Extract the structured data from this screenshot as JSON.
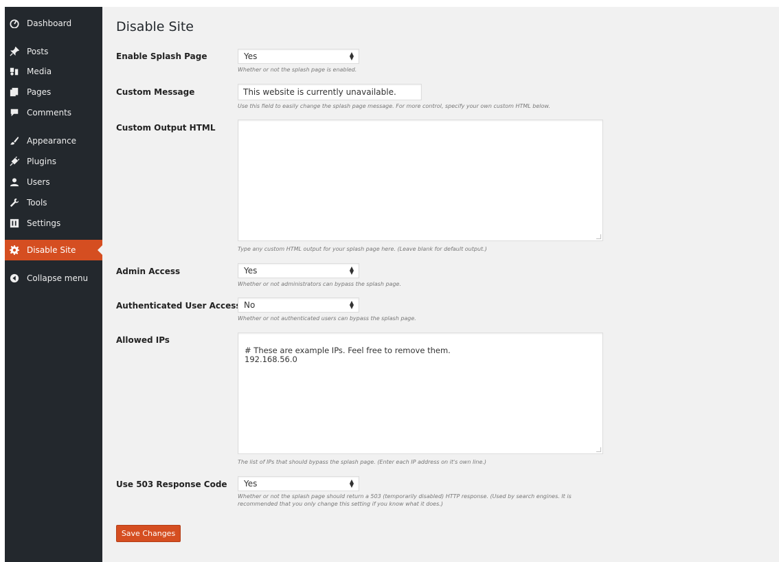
{
  "sidebar": {
    "items": [
      {
        "label": "Dashboard",
        "icon": "dashboard-icon"
      },
      {
        "label": "Posts",
        "icon": "pin-icon"
      },
      {
        "label": "Media",
        "icon": "media-icon"
      },
      {
        "label": "Pages",
        "icon": "pages-icon"
      },
      {
        "label": "Comments",
        "icon": "comment-icon"
      },
      {
        "label": "Appearance",
        "icon": "brush-icon"
      },
      {
        "label": "Plugins",
        "icon": "plug-icon"
      },
      {
        "label": "Users",
        "icon": "user-icon"
      },
      {
        "label": "Tools",
        "icon": "wrench-icon"
      },
      {
        "label": "Settings",
        "icon": "settings-icon"
      },
      {
        "label": "Disable Site",
        "icon": "gear-icon",
        "active": true
      },
      {
        "label": "Collapse menu",
        "icon": "collapse-icon"
      }
    ]
  },
  "page": {
    "title": "Disable Site"
  },
  "form": {
    "splash": {
      "label": "Enable Splash Page",
      "value": "Yes",
      "description": "Whether or not the splash page is enabled."
    },
    "message": {
      "label": "Custom Message",
      "value": "This website is currently unavailable.",
      "description": "Use this field to easily change the splash page message. For more control, specify your own custom HTML below."
    },
    "html": {
      "label": "Custom Output HTML",
      "value": "",
      "description": "Type any custom HTML output for your splash page here. (Leave blank for default output.)"
    },
    "admin": {
      "label": "Admin Access",
      "value": "Yes",
      "description": "Whether or not administrators can bypass the splash page."
    },
    "auth": {
      "label": "Authenticated User Access",
      "value": "No",
      "description": "Whether or not authenticated users can bypass the splash page."
    },
    "ips": {
      "label": "Allowed IPs",
      "value": "# These are example IPs. Feel free to remove them.\n192.168.56.0",
      "description": "The list of IPs that should bypass the splash page. (Enter each IP address on it's own line.)"
    },
    "code503": {
      "label": "Use 503 Response Code",
      "value": "Yes",
      "description_line1": "Whether or not the splash page should return a 503 (temporarily disabled) HTTP response. (Used by search engines. It is",
      "description_line2": "recommended that you only change this setting if you know what it does.)"
    },
    "save_label": "Save Changes"
  },
  "colors": {
    "sidebar_bg": "#23282d",
    "accent": "#d54e21",
    "page_bg": "#f1f1f1"
  }
}
